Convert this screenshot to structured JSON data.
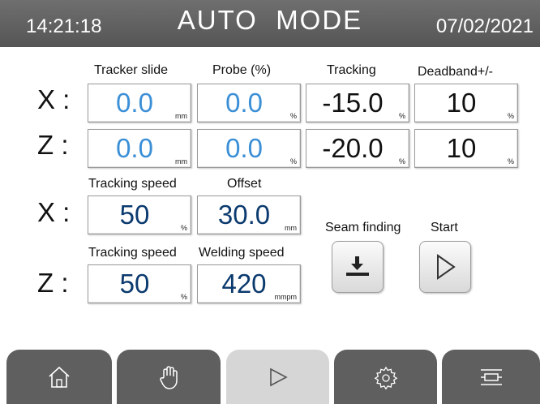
{
  "header": {
    "time": "14:21:18",
    "title": "AUTO  MODE",
    "date": "07/02/2021"
  },
  "columns": {
    "tracker_slide": "Tracker slide",
    "probe": "Probe (%)",
    "tracking": "Tracking",
    "deadband": "Deadband+/-"
  },
  "rows": {
    "x": {
      "axis": "X :",
      "tracker_slide": {
        "value": "0.0",
        "unit": "mm"
      },
      "probe": {
        "value": "0.0",
        "unit": "%"
      },
      "tracking": {
        "value": "-15.0",
        "unit": "%"
      },
      "deadband": {
        "value": "10",
        "unit": "%"
      }
    },
    "z": {
      "axis": "Z :",
      "tracker_slide": {
        "value": "0.0",
        "unit": "mm"
      },
      "probe": {
        "value": "0.0",
        "unit": "%"
      },
      "tracking": {
        "value": "-20.0",
        "unit": "%"
      },
      "deadband": {
        "value": "10",
        "unit": "%"
      }
    }
  },
  "x_speed": {
    "axis": "X :",
    "tracking_speed_label": "Tracking speed",
    "offset_label": "Offset",
    "tracking_speed": {
      "value": "50",
      "unit": "%"
    },
    "offset": {
      "value": "30.0",
      "unit": "mm"
    }
  },
  "z_speed": {
    "axis": "Z :",
    "tracking_speed_label": "Tracking speed",
    "welding_speed_label": "Welding speed",
    "tracking_speed": {
      "value": "50",
      "unit": "%"
    },
    "welding_speed": {
      "value": "420",
      "unit": "mmpm"
    }
  },
  "actions": {
    "seam_finding": "Seam finding",
    "start": "Start"
  },
  "nav": {
    "items": [
      {
        "icon": "home-icon",
        "active": false
      },
      {
        "icon": "hand-icon",
        "active": false
      },
      {
        "icon": "play-icon",
        "active": true
      },
      {
        "icon": "gear-icon",
        "active": false
      },
      {
        "icon": "menu-icon",
        "active": false
      }
    ]
  },
  "colors": {
    "header": "#5f5f5f",
    "value_blue": "#3b8fd6",
    "value_navy": "#0b3a6e",
    "nav_active": "#d6d6d6"
  }
}
